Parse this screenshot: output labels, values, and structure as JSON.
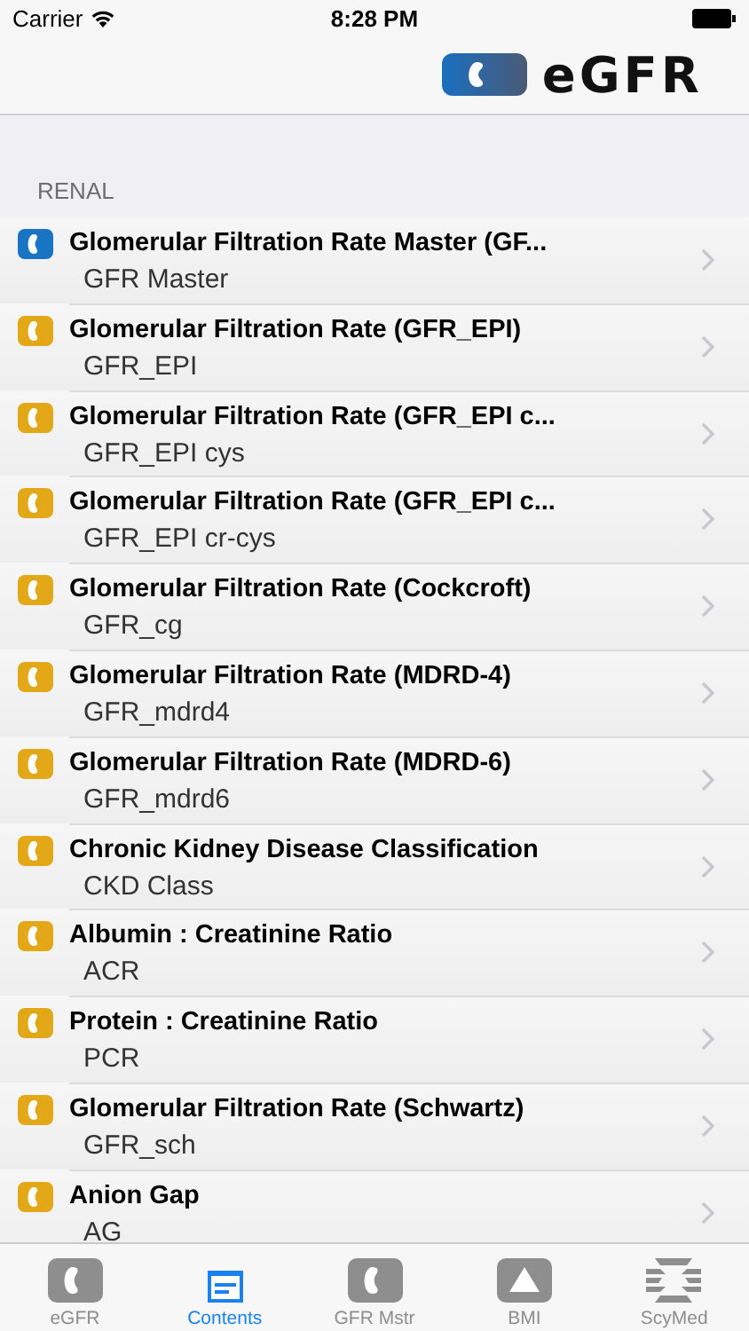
{
  "status_bar": {
    "carrier": "Carrier",
    "time": "8:28 PM"
  },
  "header": {
    "title": "eGFR"
  },
  "section": {
    "title": "RENAL"
  },
  "rows": [
    {
      "title": "Glomerular Filtration Rate Master (GF...",
      "subtitle": "GFR Master",
      "color": "#1a74c4"
    },
    {
      "title": "Glomerular Filtration Rate (GFR_EPI)",
      "subtitle": "GFR_EPI",
      "color": "#e2a818"
    },
    {
      "title": "Glomerular Filtration Rate (GFR_EPI c...",
      "subtitle": "GFR_EPI cys",
      "color": "#e2a818"
    },
    {
      "title": "Glomerular Filtration Rate (GFR_EPI c...",
      "subtitle": "GFR_EPI cr-cys",
      "color": "#e2a818"
    },
    {
      "title": "Glomerular Filtration Rate (Cockcroft)",
      "subtitle": "GFR_cg",
      "color": "#e2a818"
    },
    {
      "title": "Glomerular Filtration Rate (MDRD-4)",
      "subtitle": "GFR_mdrd4",
      "color": "#e2a818"
    },
    {
      "title": "Glomerular Filtration Rate (MDRD-6)",
      "subtitle": "GFR_mdrd6",
      "color": "#e2a818"
    },
    {
      "title": "Chronic Kidney Disease Classification",
      "subtitle": "CKD Class",
      "color": "#e2a818"
    },
    {
      "title": "Albumin : Creatinine Ratio",
      "subtitle": "ACR",
      "color": "#e2a818"
    },
    {
      "title": "Protein : Creatinine Ratio",
      "subtitle": "PCR",
      "color": "#e2a818"
    },
    {
      "title": "Glomerular Filtration Rate (Schwartz)",
      "subtitle": "GFR_sch",
      "color": "#e2a818"
    },
    {
      "title": "Anion Gap",
      "subtitle": "AG",
      "color": "#e2a818"
    }
  ],
  "tabs": [
    {
      "label": "eGFR",
      "kind": "kidney",
      "selected": false
    },
    {
      "label": "Contents",
      "kind": "contents",
      "selected": true
    },
    {
      "label": "GFR Mstr",
      "kind": "kidney",
      "selected": false
    },
    {
      "label": "BMI",
      "kind": "triangle",
      "selected": false
    },
    {
      "label": "ScyMed",
      "kind": "scymed",
      "selected": false
    }
  ]
}
